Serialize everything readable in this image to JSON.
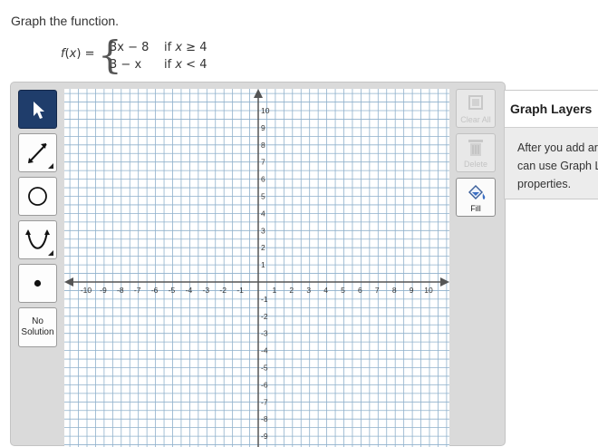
{
  "prompt": "Graph the function.",
  "function": {
    "lhs_name": "f",
    "lhs_var": "x",
    "lhs_rest": ") =",
    "cases": [
      {
        "expr_var": "3x",
        "expr_rest": " − 8",
        "cond_pre": "if ",
        "cond_var": "x",
        "cond_rest": " ≥ 4"
      },
      {
        "expr_var": "3",
        "expr_rest": " − x",
        "cond_pre": "if ",
        "cond_var": "x",
        "cond_rest": " < 4"
      }
    ]
  },
  "tools": {
    "select": "arrow-pointer-icon",
    "line": "line-segment-icon",
    "circle": "circle-icon",
    "parabola": "parabola-icon",
    "point": "point-icon",
    "no_solution_line1": "No",
    "no_solution_line2": "Solution"
  },
  "graph": {
    "x_range": [
      -10,
      10
    ],
    "y_range": [
      -10,
      10
    ],
    "x_ticks": [
      "-10",
      "-9",
      "-8",
      "-7",
      "-6",
      "-5",
      "-4",
      "-3",
      "-2",
      "-1",
      "1",
      "2",
      "3",
      "4",
      "5",
      "6",
      "7",
      "8",
      "9",
      "10"
    ],
    "y_ticks": [
      "10",
      "9",
      "8",
      "7",
      "6",
      "5",
      "4",
      "3",
      "2",
      "1",
      "-1",
      "-2",
      "-3",
      "-4",
      "-5",
      "-6",
      "-7",
      "-8",
      "-9"
    ],
    "grid": true,
    "grid_color": "#8fb1cc",
    "axis_color": "#555555"
  },
  "actions": {
    "clear_all": "Clear All",
    "delete": "Delete",
    "fill": "Fill"
  },
  "layers_panel": {
    "title": "Graph Layers",
    "lines": [
      "After you add ar",
      "can use Graph L",
      "properties."
    ]
  }
}
